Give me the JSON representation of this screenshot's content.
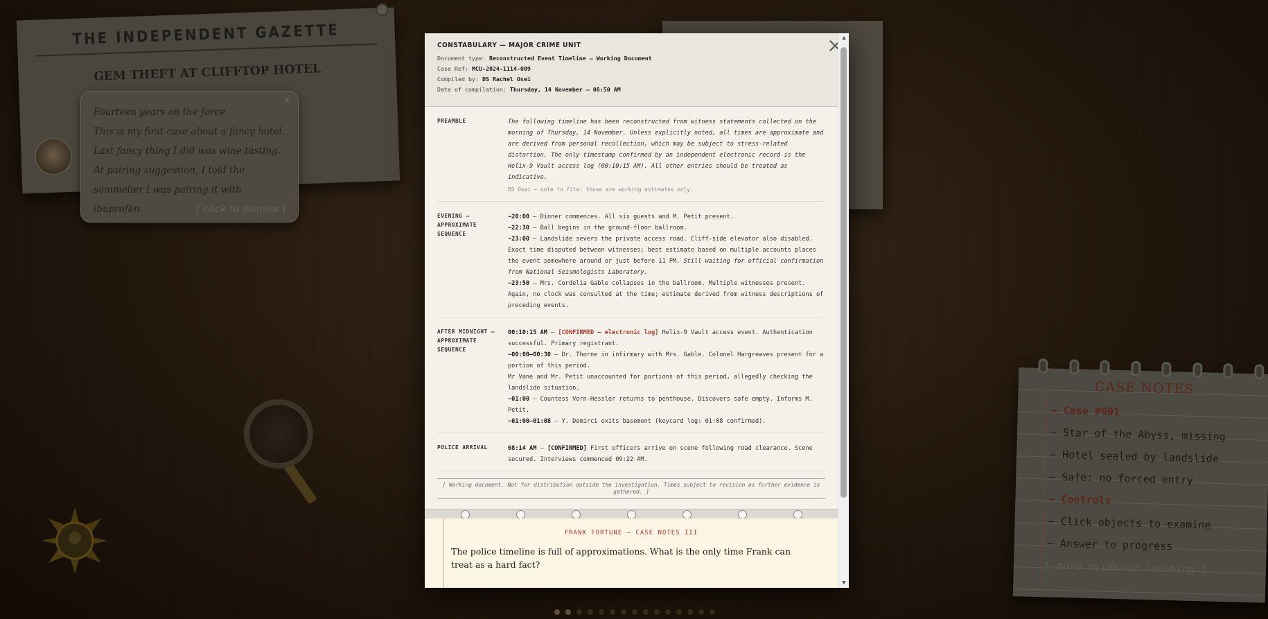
{
  "newspaper": {
    "title": "THE INDEPENDENT GAZETTE",
    "headline": "GEM THEFT AT CLIFFTOP HOTEL"
  },
  "bubble": {
    "lines": [
      "Fourteen years on the force.",
      "This is my first case about a fancy hotel.",
      "Last fancy thing I did was wine tasting. At pairing suggestion, I told the sommelier I was pairing it with ibuprofen."
    ],
    "dismiss": "[ click to dismiss ]"
  },
  "case_notes": {
    "title": "CASE NOTES",
    "items": [
      {
        "text": "– Case #001",
        "style": "hl"
      },
      {
        "text": "– Star of the Abyss, missing",
        "style": ""
      },
      {
        "text": "– Hotel sealed by landslide",
        "style": ""
      },
      {
        "text": "– Safe: no forced entry",
        "style": ""
      },
      {
        "text": "– Controls",
        "style": "hl"
      },
      {
        "text": "– Click objects to examine",
        "style": ""
      },
      {
        "text": "– Answer to progress",
        "style": ""
      },
      {
        "text": "[ more evidence incoming ]",
        "style": "muted"
      }
    ]
  },
  "document": {
    "org": "CONSTABULARY — MAJOR CRIME UNIT",
    "meta": [
      {
        "label": "Document type:",
        "value": "Reconstructed Event Timeline — Working Document"
      },
      {
        "label": "Case Ref:",
        "value": "MCU-2024-1114-009"
      },
      {
        "label": "Compiled by:",
        "value": "DS Rachel Osei"
      },
      {
        "label": "Date of compilation:",
        "value": "Thursday, 14 November — 08:50 AM"
      }
    ],
    "preamble": {
      "label": "PREAMBLE",
      "text": "The following timeline has been reconstructed from witness statements collected on the morning of Thursday, 14 November. Unless explicitly noted, all times are approximate and are derived from personal recollection, which may be subject to stress-related distortion. The only timestamp confirmed by an independent electronic record is the Helix-9 Vault access log (00:10:15 AM). All other entries should be treated as indicative.",
      "note": "DS Osei — note to file: those are working estimates only."
    },
    "evening": {
      "label": "EVENING — APPROXIMATE SEQUENCE",
      "entries": [
        {
          "time": "~20:00",
          "text": " — Dinner commences. All six guests and M. Petit present.",
          "italic": ""
        },
        {
          "time": "~22:30",
          "text": " — Ball begins in the ground-floor ballroom.",
          "italic": ""
        },
        {
          "time": "~23:00",
          "text": " — Landslide severs the private access road. Cliff-side elevator also disabled. Exact time disputed between witnesses; best estimate based on multiple accounts places the event somewhere around or just before 11 PM. ",
          "italic": "Still waiting for official confirmation from National Seismologists Laboratory."
        },
        {
          "time": "~23:50",
          "text": " — Mrs. Cordelia Gable collapses in the ballroom. Multiple witnesses present. Again, no clock was consulted at the time; estimate derived from witness descriptions of preceding events.",
          "italic": ""
        }
      ]
    },
    "after_midnight": {
      "label": "AFTER MIDNIGHT — APPROXIMATE SEQUENCE",
      "confirmed_time": "00:10:15 AM",
      "confirmed_tag": "[CONFIRMED — electronic log]",
      "confirmed_text": " Helix-9 Vault access event. Authentication successful. Primary registrant.",
      "entries": [
        {
          "time": "~00:00–00:30",
          "text": " — Dr. Thorne in infirmary with Mrs. Gable. Colonel Hargreaves present for a portion of this period."
        },
        {
          "time": "",
          "text": "Mr Vane and Mr. Petit unaccounted for portions of this period, allegedly checking the landslide situation."
        },
        {
          "time": "~01:00",
          "text": " — Countess Vorn-Hessler returns to penthouse. Discovers safe empty. Informs M. Petit."
        },
        {
          "time": "~01:00–01:08",
          "text": " — Y. Demirci exits basement (keycard log: 01:08 confirmed)."
        }
      ]
    },
    "police": {
      "label": "POLICE ARRIVAL",
      "time": "08:14 AM",
      "tag": "[CONFIRMED]",
      "text": " First officers arrive on scene following road clearance. Scene secured. Interviews commenced 09:22 AM."
    },
    "footer": "[ Working document. Not for distribution outside the investigation. Times subject to revision as further evidence is gathered. ]"
  },
  "question": {
    "title": "FRANK FORTUNE — CASE NOTES III",
    "text": "The police timeline is full of approximations. What is the only time Frank can treat as a hard fact?"
  }
}
